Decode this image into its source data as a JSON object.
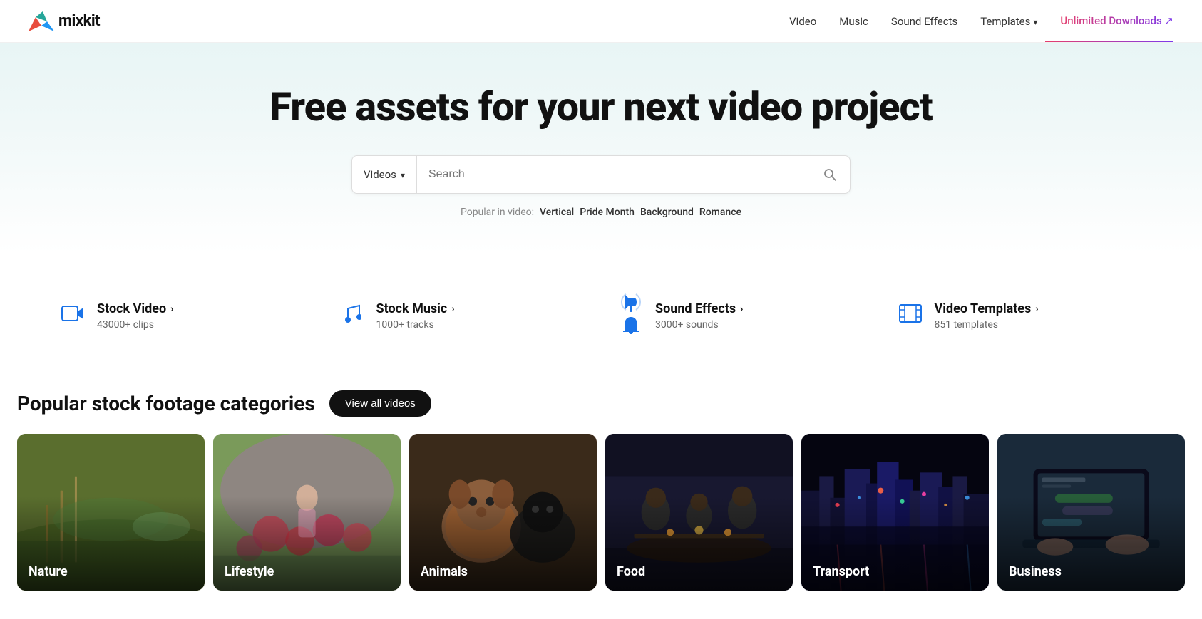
{
  "navbar": {
    "logo_text": "mixkit",
    "nav_items": [
      {
        "label": "Video",
        "id": "video"
      },
      {
        "label": "Music",
        "id": "music"
      },
      {
        "label": "Sound Effects",
        "id": "sound-effects"
      },
      {
        "label": "Templates",
        "id": "templates",
        "has_chevron": true
      },
      {
        "label": "Unlimited Downloads ↗",
        "id": "unlimited",
        "special": true
      }
    ]
  },
  "hero": {
    "title": "Free assets for your next video project"
  },
  "search": {
    "dropdown_label": "Videos",
    "placeholder": "Search",
    "popular_label": "Popular in video:",
    "popular_tags": [
      "Vertical",
      "Pride Month",
      "Background",
      "Romance"
    ]
  },
  "features": [
    {
      "id": "stock-video",
      "icon": "🎬",
      "title": "Stock Video",
      "subtitle": "43000+ clips"
    },
    {
      "id": "stock-music",
      "icon": "🎵",
      "title": "Stock Music",
      "subtitle": "1000+ tracks"
    },
    {
      "id": "sound-effects",
      "icon": "🔔",
      "title": "Sound Effects",
      "subtitle": "3000+ sounds"
    },
    {
      "id": "video-templates",
      "icon": "🎞",
      "title": "Video Templates",
      "subtitle": "851 templates"
    }
  ],
  "categories": {
    "section_title": "Popular stock footage categories",
    "view_all_label": "View all videos",
    "items": [
      {
        "id": "nature",
        "label": "Nature",
        "color_class": "cat-nature"
      },
      {
        "id": "lifestyle",
        "label": "Lifestyle",
        "color_class": "cat-lifestyle"
      },
      {
        "id": "animals",
        "label": "Animals",
        "color_class": "cat-animals"
      },
      {
        "id": "food",
        "label": "Food",
        "color_class": "cat-food"
      },
      {
        "id": "transport",
        "label": "Transport",
        "color_class": "cat-transport"
      },
      {
        "id": "business",
        "label": "Business",
        "color_class": "cat-business"
      }
    ]
  }
}
